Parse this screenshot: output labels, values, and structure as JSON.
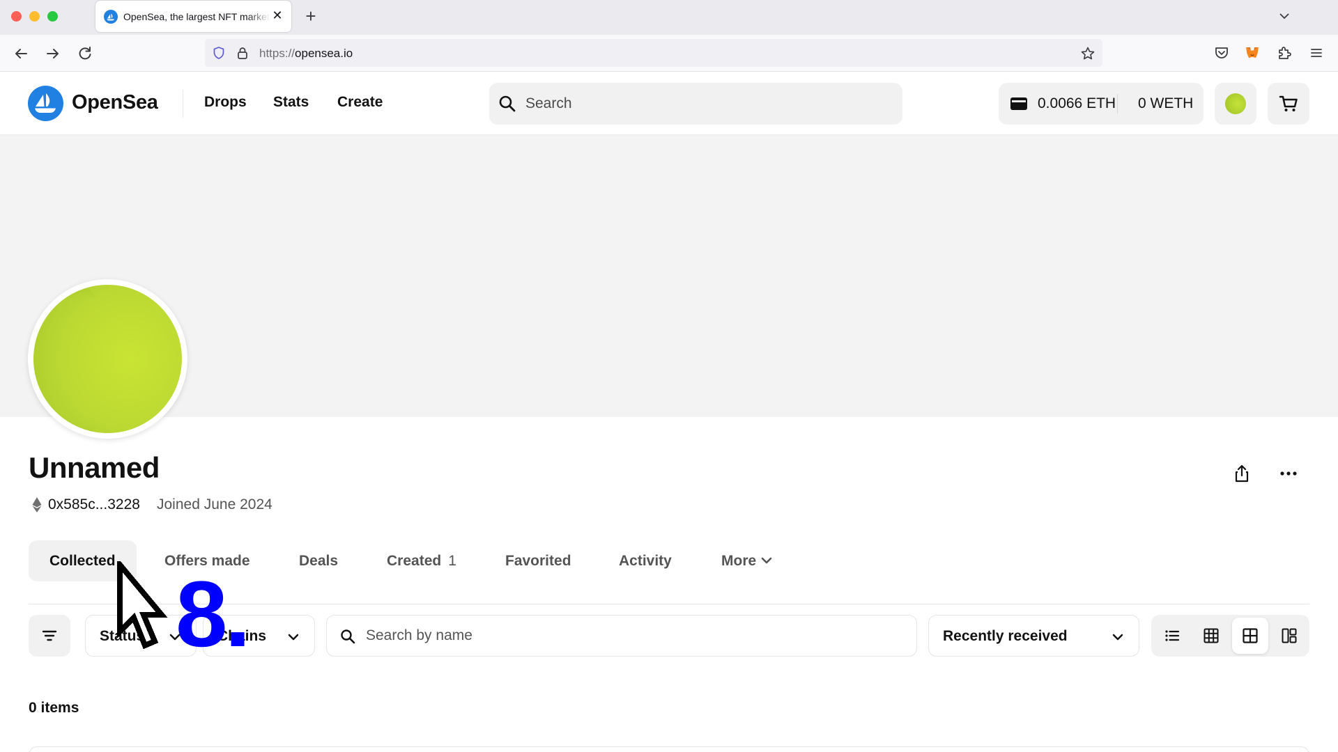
{
  "browser": {
    "tab": {
      "title": "OpenSea, the largest NFT marketplace",
      "favicon": "opensea-favicon",
      "close_glyph": "✕"
    },
    "new_tab_glyph": "+",
    "url": {
      "protocol": "https://",
      "host": "opensea.io"
    }
  },
  "header": {
    "logo_text": "OpenSea",
    "nav": [
      "Drops",
      "Stats",
      "Create"
    ],
    "search_placeholder": "Search",
    "wallet": {
      "eth": "0.0066 ETH",
      "weth": "0 WETH"
    }
  },
  "profile": {
    "name": "Unnamed",
    "address": "0x585c...3228",
    "joined": "Joined June 2024",
    "tabs": [
      {
        "label": "Collected",
        "active": true
      },
      {
        "label": "Offers made"
      },
      {
        "label": "Deals"
      },
      {
        "label": "Created",
        "count": "1"
      },
      {
        "label": "Favorited"
      },
      {
        "label": "Activity"
      },
      {
        "label": "More"
      }
    ]
  },
  "filters": {
    "status_label": "Status",
    "chains_label": "Chains",
    "search_placeholder": "Search by name",
    "sort_label": "Recently received"
  },
  "results": {
    "count_label": "0 items"
  },
  "overlay": {
    "step_label": "8."
  },
  "colors": {
    "brand_blue": "#2081e2",
    "avatar_green": "#c6e23a",
    "annotation_blue": "#0000ff"
  }
}
